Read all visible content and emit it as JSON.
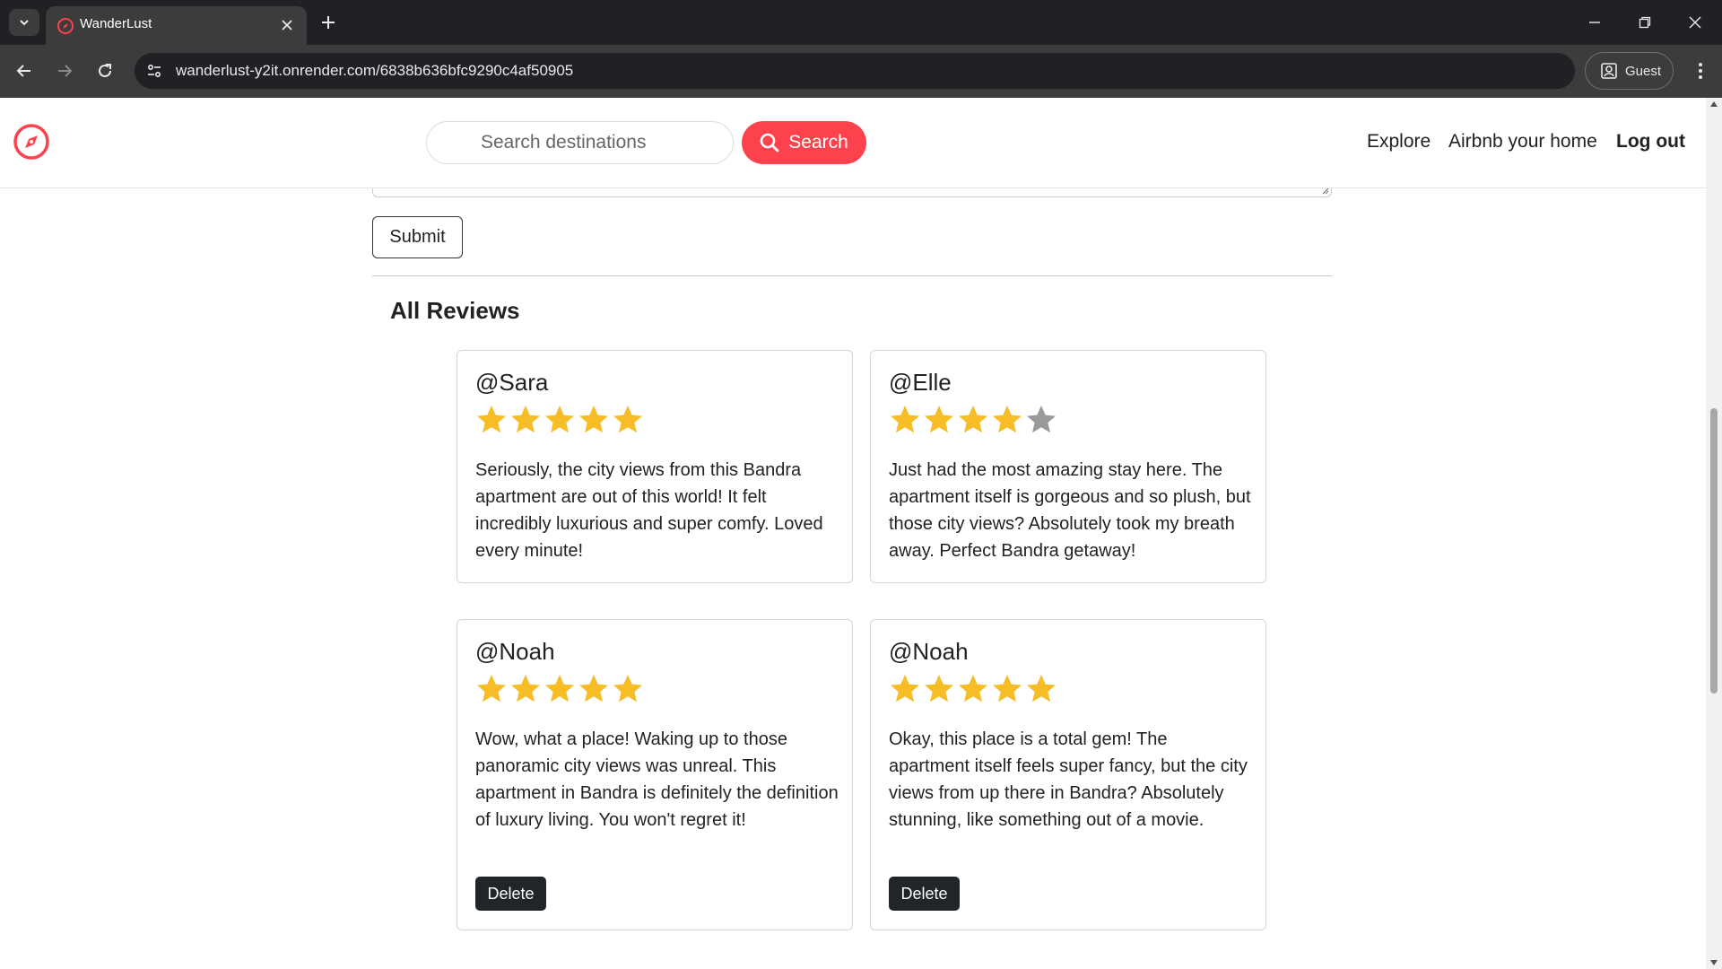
{
  "browser": {
    "tab_title": "WanderLust",
    "url": "wanderlust-y2it.onrender.com/6838b636bfc9290c4af50905",
    "profile_label": "Guest"
  },
  "navbar": {
    "search_placeholder": "Search destinations",
    "search_button": "Search",
    "links": [
      "Explore",
      "Airbnb your home",
      "Log out"
    ],
    "brand_color": "#fe424d"
  },
  "form": {
    "submit_label": "Submit"
  },
  "reviews": {
    "title": "All Reviews",
    "star_color": "#f6bd26",
    "empty_star_color": "#999999",
    "items": [
      {
        "author": "@Sara",
        "rating": 5,
        "text": "Seriously, the city views from this Bandra apartment are out of this world! It felt incredibly luxurious and super comfy. Loved every minute!",
        "delete_label": ""
      },
      {
        "author": "@Elle",
        "rating": 4,
        "text": "Just had the most amazing stay here. The apartment itself is gorgeous and so plush, but those city views? Absolutely took my breath away. Perfect Bandra getaway!",
        "delete_label": ""
      },
      {
        "author": "@Noah",
        "rating": 5,
        "text": "Wow, what a place! Waking up to those panoramic city views was unreal. This apartment in Bandra is definitely the definition of luxury living. You won't regret it!",
        "delete_label": "Delete"
      },
      {
        "author": "@Noah",
        "rating": 5,
        "text": "Okay, this place is a total gem! The apartment itself feels super fancy, but the city views from up there in Bandra? Absolutely stunning, like something out of a movie.",
        "delete_label": "Delete"
      }
    ]
  }
}
